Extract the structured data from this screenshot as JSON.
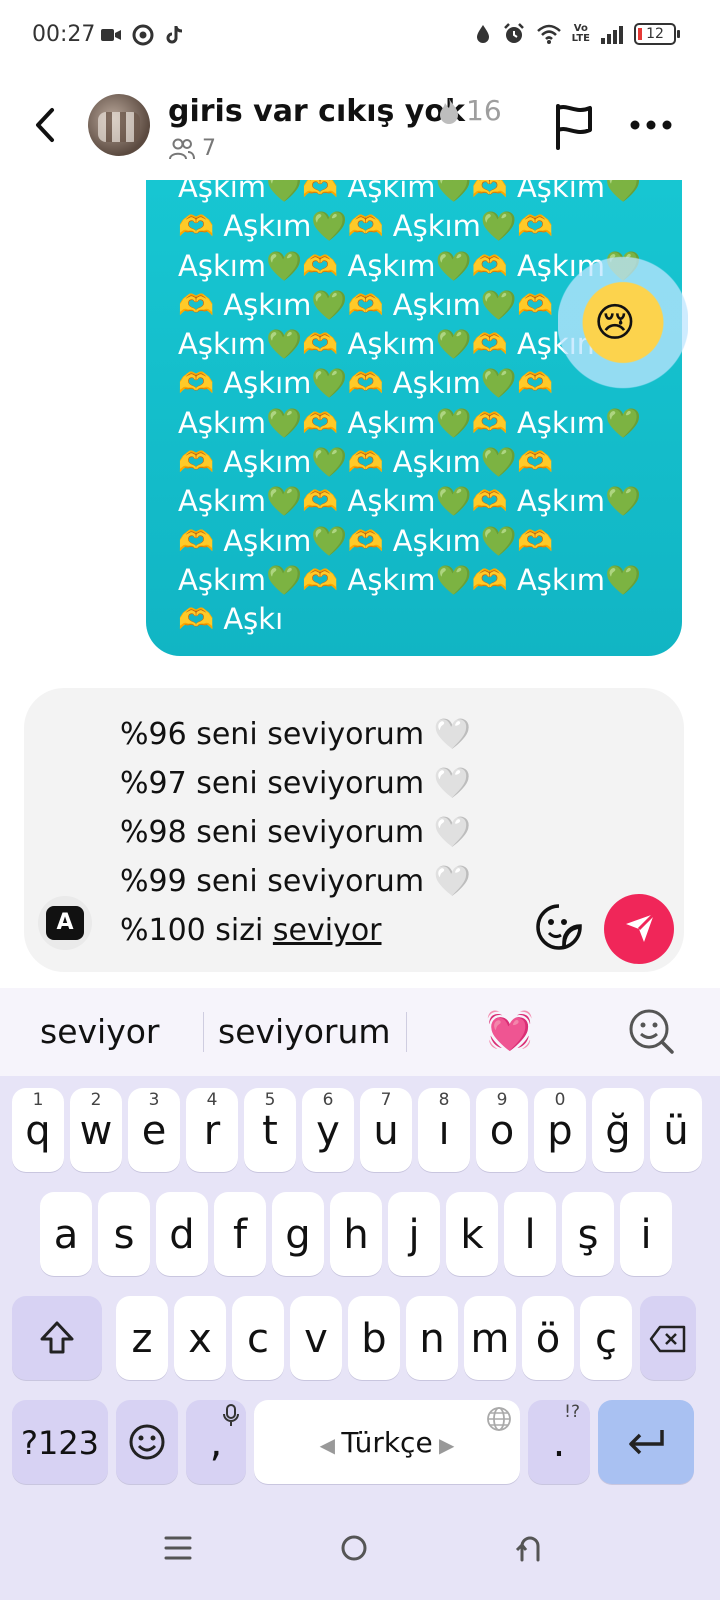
{
  "status_bar": {
    "time": "00:27",
    "left_icons": [
      "video-icon",
      "chrome-icon",
      "tiktok-icon"
    ],
    "volte_label": "Vo\nLTE",
    "battery_level": "12"
  },
  "header": {
    "title": "giris var cıkış yok",
    "streak_count": "16",
    "member_count": "7"
  },
  "message": {
    "text": "Aşkım💚🫶 Aşkım💚🫶 Aşkım💚\n🫶 Aşkım💚🫶 Aşkım💚🫶\nAşkım💚🫶 Aşkım💚🫶 Aşkım💚\n🫶 Aşkım💚🫶 Aşkım💚🫶\nAşkım💚🫶 Aşkım💚🫶 Aşkım💚\n🫶 Aşkım💚🫶 Aşkım💚🫶\nAşkım💚🫶 Aşkım💚🫶 Aşkım💚\n🫶 Aşkım💚🫶 Aşkım💚🫶\nAşkım💚🫶 Aşkım💚🫶 Aşkım💚\n🫶 Aşkım💚🫶 Aşkım💚🫶\nAşkım💚🫶 Aşkım💚🫶 Aşkım💚\n🫶 Aşkı",
    "bubble_color": "#17c6d2"
  },
  "composer": {
    "lines": [
      "%96 seni seviyorum 🤍",
      "%97 seni seviyorum 🤍",
      "%98 seni seviyorum 🤍",
      "%99 seni seviyorum 🤍"
    ],
    "last_line_prefix": "%100 sizi ",
    "last_line_word": "seviyor",
    "a_button_label": "A",
    "send_color": "#f02659"
  },
  "suggestions": {
    "first": "seviyor",
    "second": "seviyorum",
    "emoji": "💓"
  },
  "keyboard": {
    "row1": [
      "q",
      "w",
      "e",
      "r",
      "t",
      "y",
      "u",
      "ı",
      "o",
      "p",
      "ğ",
      "ü"
    ],
    "row1_numbers": [
      "1",
      "2",
      "3",
      "4",
      "5",
      "6",
      "7",
      "8",
      "9",
      "0",
      "",
      ""
    ],
    "row2": [
      "a",
      "s",
      "d",
      "f",
      "g",
      "h",
      "j",
      "k",
      "l",
      "ş",
      "i"
    ],
    "row3": [
      "z",
      "x",
      "c",
      "v",
      "b",
      "n",
      "m",
      "ö",
      "ç"
    ],
    "symbols_label": "?123",
    "comma": ",",
    "space_label": "Türkçe",
    "period": ".",
    "period_hint": "!?"
  }
}
